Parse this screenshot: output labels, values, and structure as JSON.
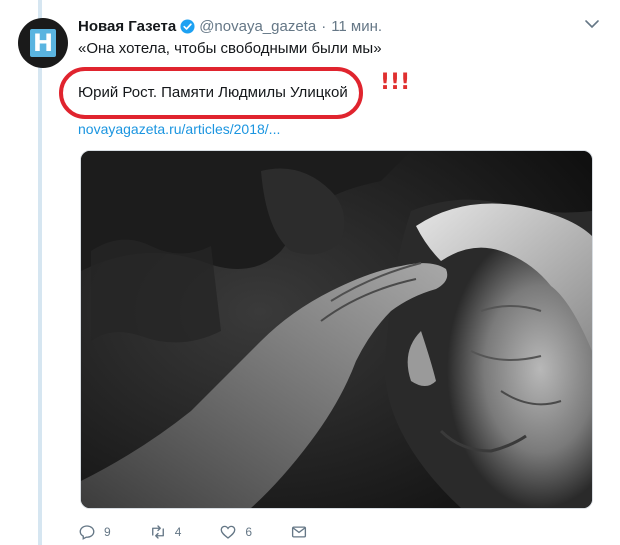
{
  "tweet": {
    "avatar_letter": "Н",
    "name": "Новая Газета",
    "handle": "@novaya_gazeta",
    "separator": "·",
    "time": "11 мин.",
    "text_line1": "«Она хотела, чтобы свободными были мы»",
    "text_line2": "Юрий Рост. Памяти Людмилы Улицкой",
    "link": "novayagazeta.ru/articles/2018/...",
    "annotation": "!!!",
    "actions": {
      "replies": "9",
      "retweets": "4",
      "likes": "6"
    }
  },
  "colors": {
    "accent": "#1b95e0",
    "annotation": "#e03030",
    "thread_line": "#d6e6f1",
    "muted": "#657786"
  },
  "icons": [
    "verified-badge-icon",
    "chevron-down-icon",
    "reply-icon",
    "retweet-icon",
    "like-icon",
    "message-icon"
  ]
}
